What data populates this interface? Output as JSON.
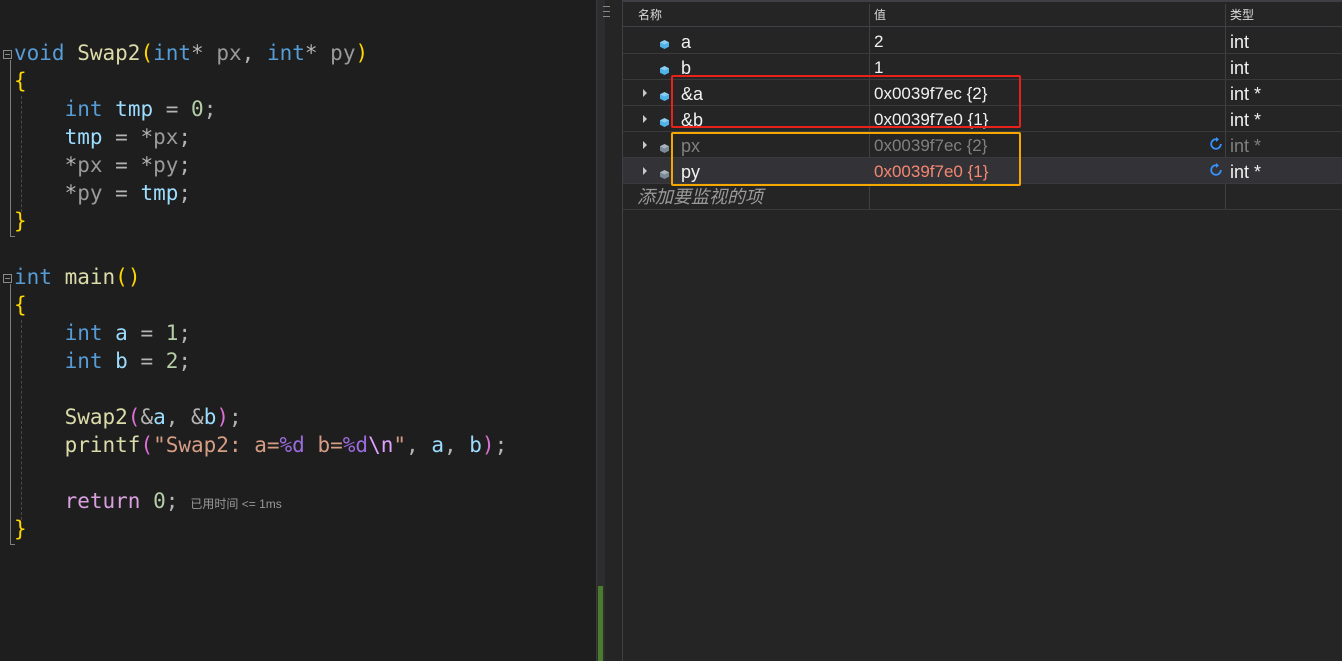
{
  "editor": {
    "lines": [
      [
        [
          "kw",
          "void"
        ],
        [
          "plain",
          " "
        ],
        [
          "fn",
          "Swap2"
        ],
        [
          "br1",
          "("
        ],
        [
          "kw",
          "int"
        ],
        [
          "op",
          "* "
        ],
        [
          "param",
          "px"
        ],
        [
          "op",
          ", "
        ],
        [
          "kw",
          "int"
        ],
        [
          "op",
          "* "
        ],
        [
          "param",
          "py"
        ],
        [
          "br1",
          ")"
        ]
      ],
      [
        [
          "br1",
          "{"
        ]
      ],
      [
        [
          "plain",
          "    "
        ],
        [
          "kw",
          "int"
        ],
        [
          "plain",
          " "
        ],
        [
          "var",
          "tmp"
        ],
        [
          "op",
          " = "
        ],
        [
          "num",
          "0"
        ],
        [
          "op",
          ";"
        ]
      ],
      [
        [
          "plain",
          "    "
        ],
        [
          "var",
          "tmp"
        ],
        [
          "op",
          " = *"
        ],
        [
          "param",
          "px"
        ],
        [
          "op",
          ";"
        ]
      ],
      [
        [
          "plain",
          "    "
        ],
        [
          "op",
          "*"
        ],
        [
          "param",
          "px"
        ],
        [
          "op",
          " = *"
        ],
        [
          "param",
          "py"
        ],
        [
          "op",
          ";"
        ]
      ],
      [
        [
          "plain",
          "    "
        ],
        [
          "op",
          "*"
        ],
        [
          "param",
          "py"
        ],
        [
          "op",
          " = "
        ],
        [
          "var",
          "tmp"
        ],
        [
          "op",
          ";"
        ]
      ],
      [
        [
          "br1",
          "}"
        ]
      ],
      [],
      [
        [
          "kw",
          "int"
        ],
        [
          "plain",
          " "
        ],
        [
          "fn",
          "main"
        ],
        [
          "br1",
          "()"
        ]
      ],
      [
        [
          "br1",
          "{"
        ]
      ],
      [
        [
          "plain",
          "    "
        ],
        [
          "kw",
          "int"
        ],
        [
          "plain",
          " "
        ],
        [
          "var",
          "a"
        ],
        [
          "op",
          " = "
        ],
        [
          "num",
          "1"
        ],
        [
          "op",
          ";"
        ]
      ],
      [
        [
          "plain",
          "    "
        ],
        [
          "kw",
          "int"
        ],
        [
          "plain",
          " "
        ],
        [
          "var",
          "b"
        ],
        [
          "op",
          " = "
        ],
        [
          "num",
          "2"
        ],
        [
          "op",
          ";"
        ]
      ],
      [],
      [
        [
          "plain",
          "    "
        ],
        [
          "fn",
          "Swap2"
        ],
        [
          "br2",
          "("
        ],
        [
          "op",
          "&"
        ],
        [
          "var",
          "a"
        ],
        [
          "op",
          ", &"
        ],
        [
          "var",
          "b"
        ],
        [
          "br2",
          ")"
        ],
        [
          "op",
          ";"
        ]
      ],
      [
        [
          "plain",
          "    "
        ],
        [
          "fn",
          "printf"
        ],
        [
          "br2",
          "("
        ],
        [
          "str",
          "\"Swap2: a="
        ],
        [
          "fmt",
          "%d"
        ],
        [
          "str",
          " b="
        ],
        [
          "fmt",
          "%d"
        ],
        [
          "esc",
          "\\n"
        ],
        [
          "str",
          "\""
        ],
        [
          "op",
          ", "
        ],
        [
          "var",
          "a"
        ],
        [
          "op",
          ", "
        ],
        [
          "var",
          "b"
        ],
        [
          "br2",
          ")"
        ],
        [
          "op",
          ";"
        ]
      ],
      [],
      [
        [
          "plain",
          "    "
        ],
        [
          "ret",
          "return"
        ],
        [
          "plain",
          " "
        ],
        [
          "num",
          "0"
        ],
        [
          "op",
          ";"
        ]
      ],
      [
        [
          "br1",
          "}"
        ]
      ]
    ],
    "elapsed_label": "已用时间 <= 1ms"
  },
  "watch": {
    "headers": {
      "name": "名称",
      "value": "值",
      "type": "类型"
    },
    "rows": [
      {
        "name": "a",
        "value": "2",
        "type": "int",
        "expandable": false,
        "stale": false,
        "changed": false
      },
      {
        "name": "b",
        "value": "1",
        "type": "int",
        "expandable": false,
        "stale": false,
        "changed": false
      },
      {
        "name": "&a",
        "value": "0x0039f7ec {2}",
        "type": "int *",
        "expandable": true,
        "stale": false,
        "changed": false
      },
      {
        "name": "&b",
        "value": "0x0039f7e0 {1}",
        "type": "int *",
        "expandable": true,
        "stale": false,
        "changed": false
      },
      {
        "name": "px",
        "value": "0x0039f7ec {2}",
        "type": "int *",
        "expandable": true,
        "stale": true,
        "changed": false
      },
      {
        "name": "py",
        "value": "0x0039f7e0 {1}",
        "type": "int *",
        "expandable": true,
        "stale": true,
        "changed": true
      }
    ],
    "add_watch_placeholder": "添加要监视的项"
  },
  "colors": {
    "highlight_red": "#e8211b",
    "highlight_orange": "#f4a700",
    "changed_value": "#f48771",
    "cube_icon": "#4fb3e8",
    "refresh_icon": "#3794ff"
  },
  "icons": {
    "variable": "cube-icon",
    "refresh": "refresh-icon",
    "expand": "expand-arrow-icon",
    "collapse": "collapse-minus-icon"
  }
}
